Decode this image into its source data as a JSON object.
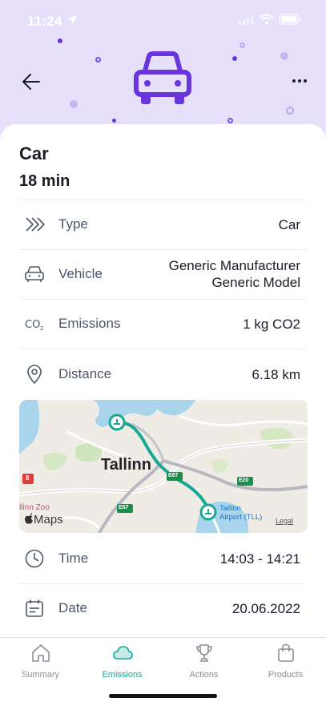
{
  "status_bar": {
    "time": "11:24"
  },
  "header": {
    "hero_icon": "car-icon"
  },
  "trip": {
    "title": "Car",
    "duration": "18 min"
  },
  "details": [
    {
      "icon": "chevrons-icon",
      "label": "Type",
      "value": "Car"
    },
    {
      "icon": "car-icon",
      "label": "Vehicle",
      "value_line1": "Generic Manufacturer",
      "value_line2": "Generic Model"
    },
    {
      "icon": "co2-icon",
      "label": "Emissions",
      "value": "1 kg CO2"
    },
    {
      "icon": "location-pin-icon",
      "label": "Distance",
      "value": "6.18 km"
    },
    {
      "icon": "clock-icon",
      "label": "Time",
      "value": "14:03 - 14:21"
    },
    {
      "icon": "calendar-icon",
      "label": "Date",
      "value": "20.06.2022"
    }
  ],
  "map": {
    "city_label": "Tallinn",
    "airport_label_line1": "Tallinn",
    "airport_label_line2": "Airport (TLL)",
    "zoo_label": "llinn Zoo",
    "maps_brand": "Maps",
    "legal": "Legal",
    "road_labels": [
      "E67",
      "E20",
      "E67",
      "8"
    ],
    "route_color": "#1aa896"
  },
  "tabs": [
    {
      "icon": "home-icon",
      "label": "Summary",
      "active": false
    },
    {
      "icon": "cloud-icon",
      "label": "Emissions",
      "active": true
    },
    {
      "icon": "trophy-icon",
      "label": "Actions",
      "active": false
    },
    {
      "icon": "shopping-bag-icon",
      "label": "Products",
      "active": false
    }
  ],
  "colors": {
    "accent_purple": "#6a34dc",
    "accent_teal": "#19a89a",
    "hero_bg": "#e6e0fb"
  }
}
